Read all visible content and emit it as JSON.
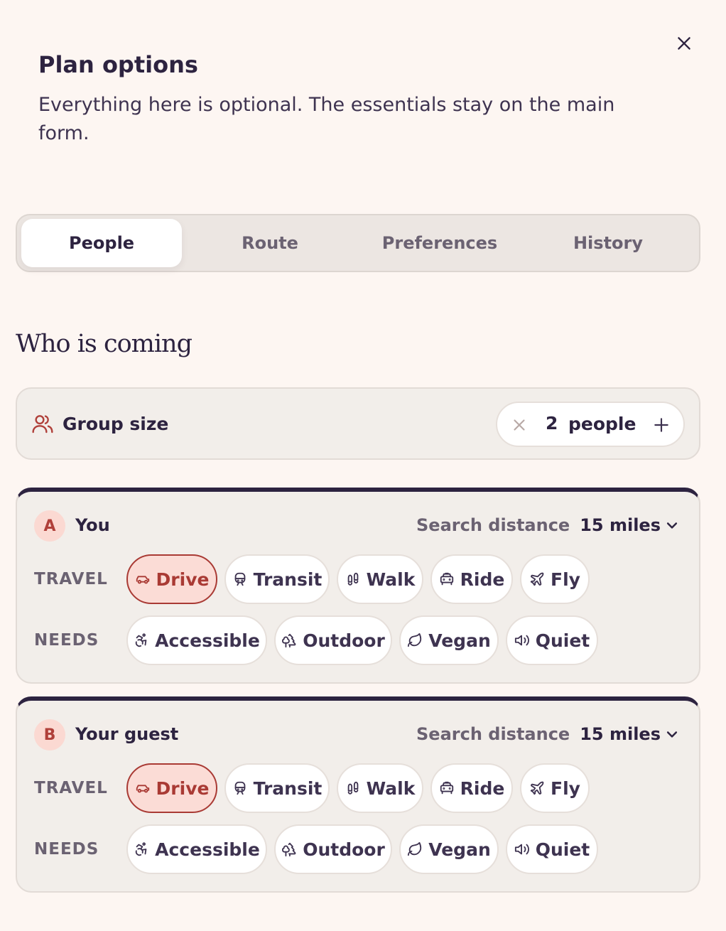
{
  "header": {
    "title": "Plan options",
    "subtitle": "Everything here is optional. The essentials stay on the main form."
  },
  "tabs": [
    {
      "label": "People",
      "active": true
    },
    {
      "label": "Route",
      "active": false
    },
    {
      "label": "Preferences",
      "active": false
    },
    {
      "label": "History",
      "active": false
    }
  ],
  "section": {
    "heading": "Who is coming"
  },
  "group": {
    "label": "Group size",
    "count": "2",
    "unit": "people"
  },
  "travel_label": "TRAVEL",
  "needs_label": "NEEDS",
  "people": [
    {
      "badge": "A",
      "name": "You",
      "distance_label": "Search distance",
      "distance_value": "15 miles",
      "travel": [
        {
          "label": "Drive",
          "icon": "car-icon",
          "selected": true
        },
        {
          "label": "Transit",
          "icon": "train-icon",
          "selected": false
        },
        {
          "label": "Walk",
          "icon": "footprints-icon",
          "selected": false
        },
        {
          "label": "Ride",
          "icon": "taxi-icon",
          "selected": false
        },
        {
          "label": "Fly",
          "icon": "plane-icon",
          "selected": false
        }
      ],
      "needs": [
        {
          "label": "Accessible",
          "icon": "accessible-icon"
        },
        {
          "label": "Outdoor",
          "icon": "trees-icon"
        },
        {
          "label": "Vegan",
          "icon": "leaf-icon"
        },
        {
          "label": "Quiet",
          "icon": "speaker-icon"
        }
      ]
    },
    {
      "badge": "B",
      "name": "Your guest",
      "distance_label": "Search distance",
      "distance_value": "15 miles",
      "travel": [
        {
          "label": "Drive",
          "icon": "car-icon",
          "selected": true
        },
        {
          "label": "Transit",
          "icon": "train-icon",
          "selected": false
        },
        {
          "label": "Walk",
          "icon": "footprints-icon",
          "selected": false
        },
        {
          "label": "Ride",
          "icon": "taxi-icon",
          "selected": false
        },
        {
          "label": "Fly",
          "icon": "plane-icon",
          "selected": false
        }
      ],
      "needs": [
        {
          "label": "Accessible",
          "icon": "accessible-icon"
        },
        {
          "label": "Outdoor",
          "icon": "trees-icon"
        },
        {
          "label": "Vegan",
          "icon": "leaf-icon"
        },
        {
          "label": "Quiet",
          "icon": "speaker-icon"
        }
      ]
    }
  ],
  "colors": {
    "background": "#fdf6f2",
    "text": "#2d2340",
    "accent": "#a93a34",
    "accent_soft": "#fbdcd6"
  }
}
